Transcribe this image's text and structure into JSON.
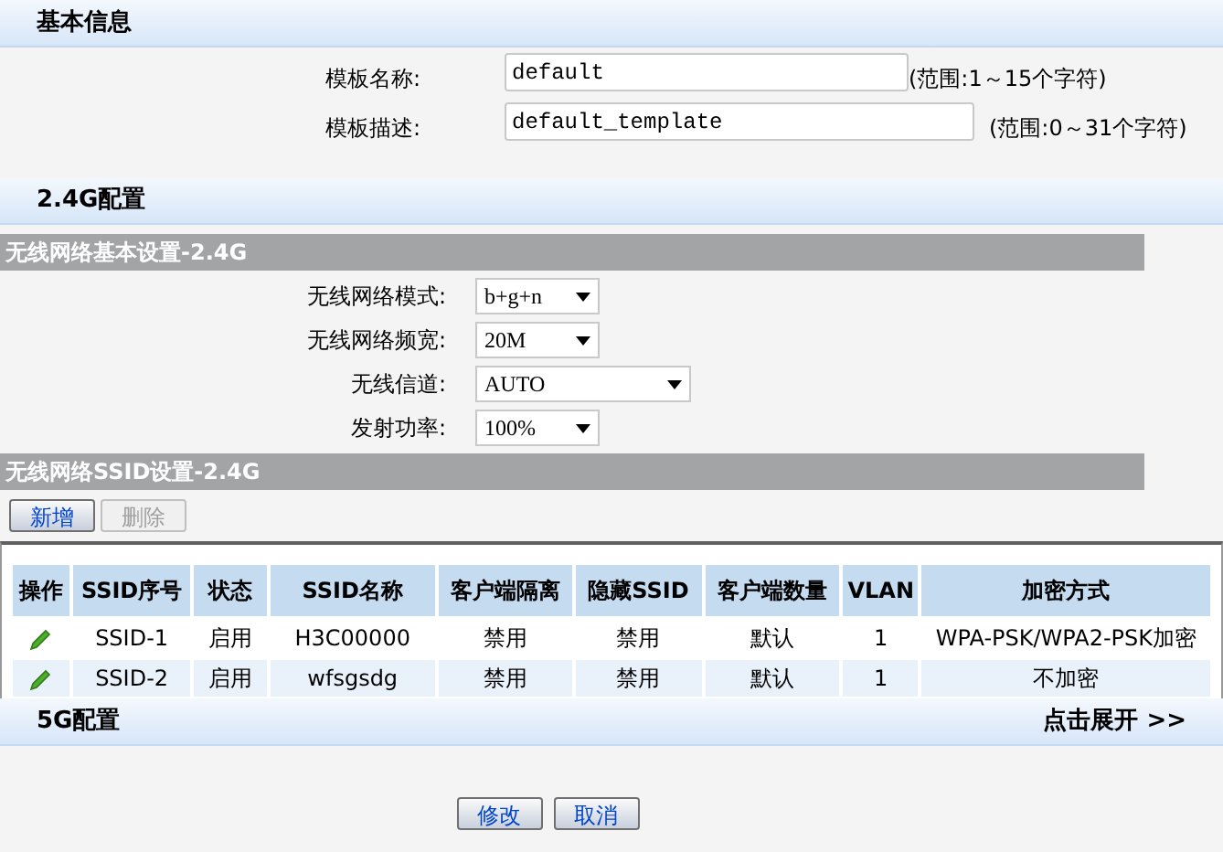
{
  "basic": {
    "title": "基本信息",
    "fields": [
      {
        "label": "模板名称:",
        "value": "default",
        "hint": "(范围:1～15个字符)"
      },
      {
        "label": "模板描述:",
        "value": "default_template",
        "hint": "(范围:0～31个字符)"
      }
    ]
  },
  "band24": {
    "title": "2.4G配置",
    "basic_settings": {
      "title": "无线网络基本设置-2.4G",
      "fields": [
        {
          "label": "无线网络模式:",
          "value": "b+g+n",
          "wide": false
        },
        {
          "label": "无线网络频宽:",
          "value": "20M",
          "wide": false
        },
        {
          "label": "无线信道:",
          "value": "AUTO",
          "wide": true
        },
        {
          "label": "发射功率:",
          "value": "100%",
          "wide": false
        }
      ]
    },
    "ssid_settings": {
      "title": "无线网络SSID设置-2.4G",
      "buttons": [
        {
          "label": "新增",
          "disabled": false
        },
        {
          "label": "删除",
          "disabled": true
        }
      ],
      "table": {
        "columns": [
          "操作",
          "SSID序号",
          "状态",
          "SSID名称",
          "客户端隔离",
          "隐藏SSID",
          "客户端数量",
          "VLAN",
          "加密方式"
        ],
        "rows": [
          [
            "",
            "SSID-1",
            "启用",
            "H3C00000",
            "禁用",
            "禁用",
            "默认",
            "1",
            "WPA-PSK/WPA2-PSK加密"
          ],
          [
            "",
            "SSID-2",
            "启用",
            "wfsgsdg",
            "禁用",
            "禁用",
            "默认",
            "1",
            "不加密"
          ]
        ]
      }
    }
  },
  "band5": {
    "title": "5G配置",
    "expand": "点击展开 >>"
  },
  "buttons": [
    "修改",
    "取消"
  ]
}
